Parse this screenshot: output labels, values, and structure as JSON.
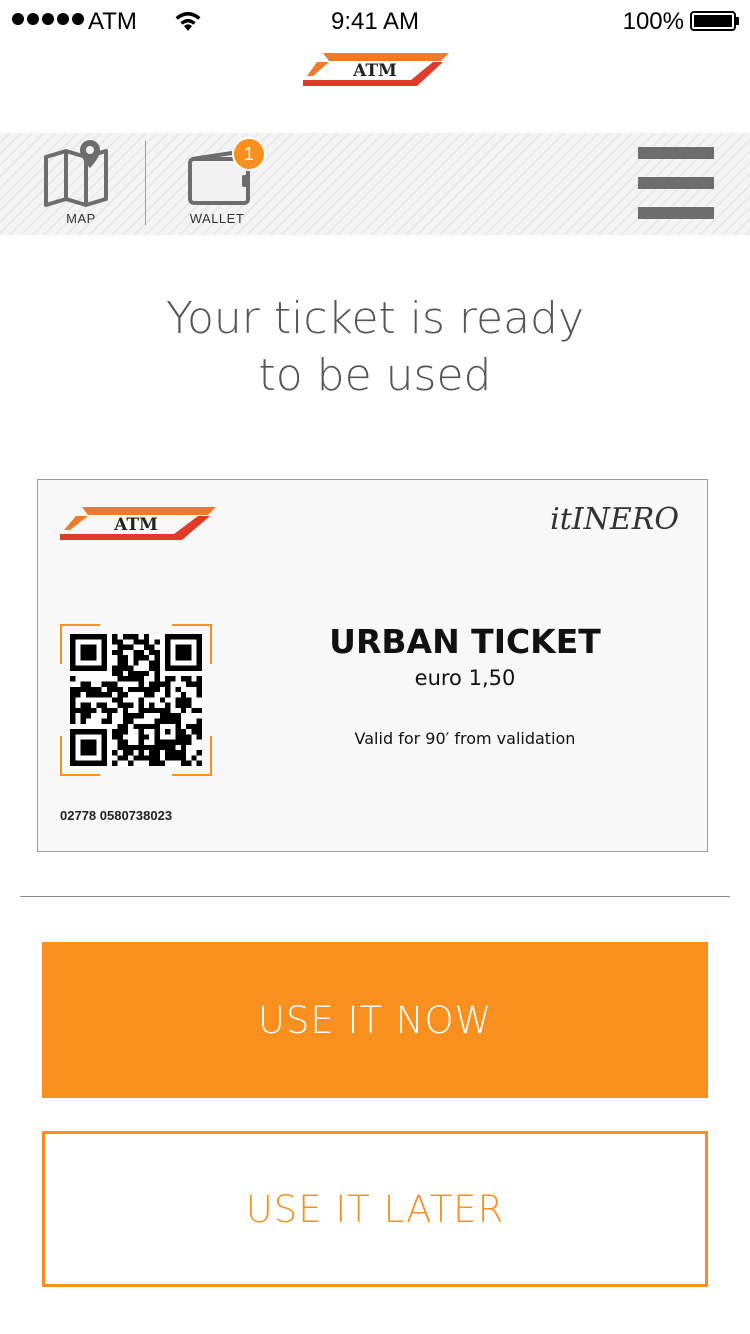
{
  "status_bar": {
    "carrier": "ATM",
    "time": "9:41 AM",
    "battery": "100%",
    "icons": [
      "signal-dots-icon",
      "wifi-icon",
      "battery-icon"
    ]
  },
  "header": {
    "logo_text": "ATM"
  },
  "toolbar": {
    "map_label": "MAP",
    "wallet_label": "WALLET",
    "wallet_badge": "1",
    "icons": [
      "map-icon",
      "wallet-icon",
      "hamburger-menu-icon"
    ]
  },
  "main": {
    "title_line1": "Your ticket is ready",
    "title_line2": "to be used"
  },
  "ticket": {
    "logo_text": "ATM",
    "brand": "itINERO",
    "name": "URBAN TICKET",
    "price": "euro 1,50",
    "validity": "Valid for 90′ from validation",
    "serial": "02778 0580738023"
  },
  "actions": {
    "use_now_label": "USE IT NOW",
    "use_later_label": "USE IT LATER"
  },
  "colors": {
    "accent": "#f7901e",
    "logo_red": "#e03a2b",
    "logo_orange": "#ee7a2a",
    "toolbar_icon": "#6d6d6d"
  }
}
